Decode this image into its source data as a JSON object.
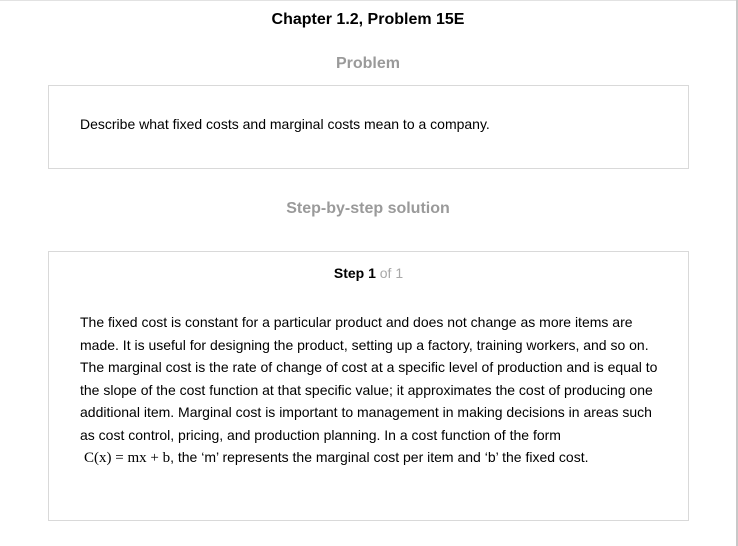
{
  "chapter_title": "Chapter 1.2, Problem 15E",
  "problem_heading": "Problem",
  "problem_text": "Describe what fixed costs and marginal costs mean to a company.",
  "solution_heading": "Step-by-step solution",
  "step": {
    "step_word": "Step 1",
    "of_text": "of 1"
  },
  "solution": {
    "main_text": "The fixed cost is constant for a particular product and does not change as more items are made. It is useful for designing the product, setting up a factory, training workers, and so on. The marginal cost is the rate of change of cost at a specific level of production and is equal to the slope of the cost function at that specific value; it approximates the cost of producing one additional item. Marginal cost is important to management in making decisions in areas such as cost control, pricing, and production planning. In a cost function of the form",
    "formula": "C(x) = mx + b",
    "tail_text": ", the ‘m’ represents the marginal cost per item and ‘b’ the fixed cost."
  }
}
